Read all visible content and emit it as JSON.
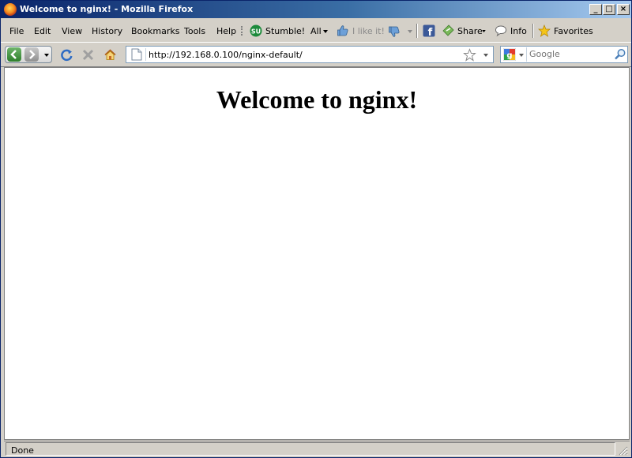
{
  "window": {
    "title": "Welcome to nginx! - Mozilla Firefox",
    "controls": {
      "minimize": "_",
      "maximize": "□",
      "close": "×"
    }
  },
  "menubar": {
    "items": [
      "File",
      "Edit",
      "View",
      "History",
      "Bookmarks",
      "Tools",
      "Help"
    ]
  },
  "toolbar": {
    "stumble_label": "Stumble!",
    "all_label": "All",
    "like_label": "I like it!",
    "share_label": "Share",
    "info_label": "Info",
    "favorites_label": "Favorites"
  },
  "navbar": {
    "url": "http://192.168.0.100/nginx-default/",
    "search_placeholder": "Google"
  },
  "page": {
    "heading": "Welcome to nginx!"
  },
  "statusbar": {
    "text": "Done"
  }
}
